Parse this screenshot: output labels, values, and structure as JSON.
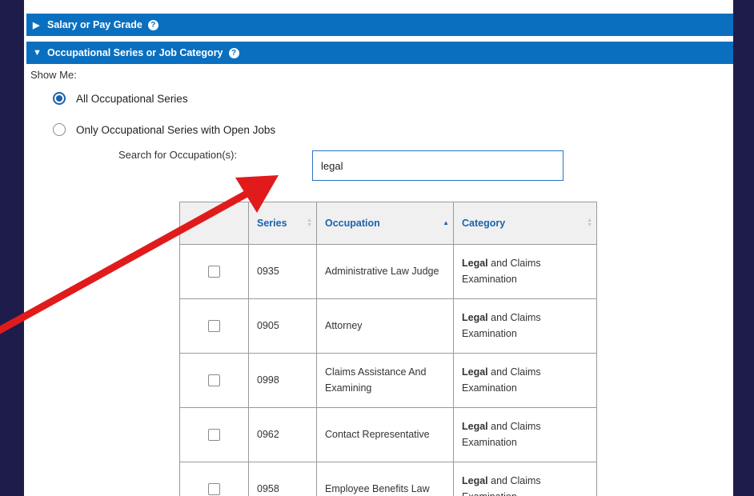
{
  "accordion": {
    "salary_label": "Salary or Pay Grade",
    "occ_label": "Occupational Series or Job Category",
    "help_glyph": "?"
  },
  "filters": {
    "show_me_label": "Show Me:",
    "option_all": "All Occupational Series",
    "option_open": "Only Occupational Series with Open Jobs",
    "selected": "All Occupational Series"
  },
  "search": {
    "label": "Search for Occupation(s):",
    "value": "legal"
  },
  "table": {
    "headers": [
      "",
      "Series",
      "Occupation",
      "Category"
    ],
    "rows": [
      {
        "series": "0935",
        "occupation": "Administrative Law Judge",
        "category_bold": "Legal",
        "category_rest": " and Claims Examination"
      },
      {
        "series": "0905",
        "occupation": "Attorney",
        "category_bold": "Legal",
        "category_rest": " and Claims Examination"
      },
      {
        "series": "0998",
        "occupation": "Claims Assistance And Examining",
        "category_bold": "Legal",
        "category_rest": " and Claims Examination"
      },
      {
        "series": "0962",
        "occupation": "Contact Representative",
        "category_bold": "Legal",
        "category_rest": " and Claims Examination"
      },
      {
        "series": "0958",
        "occupation": "Employee Benefits Law",
        "category_bold": "Legal",
        "category_rest": " and Claims Examination"
      }
    ]
  },
  "colors": {
    "header_blue": "#0a6fbf",
    "background": "#1e1c4a",
    "arrow": "#e11b1b"
  },
  "icons": {
    "collapsed": "triangle-right-icon",
    "expanded": "triangle-down-icon",
    "help": "question-circle-icon"
  }
}
